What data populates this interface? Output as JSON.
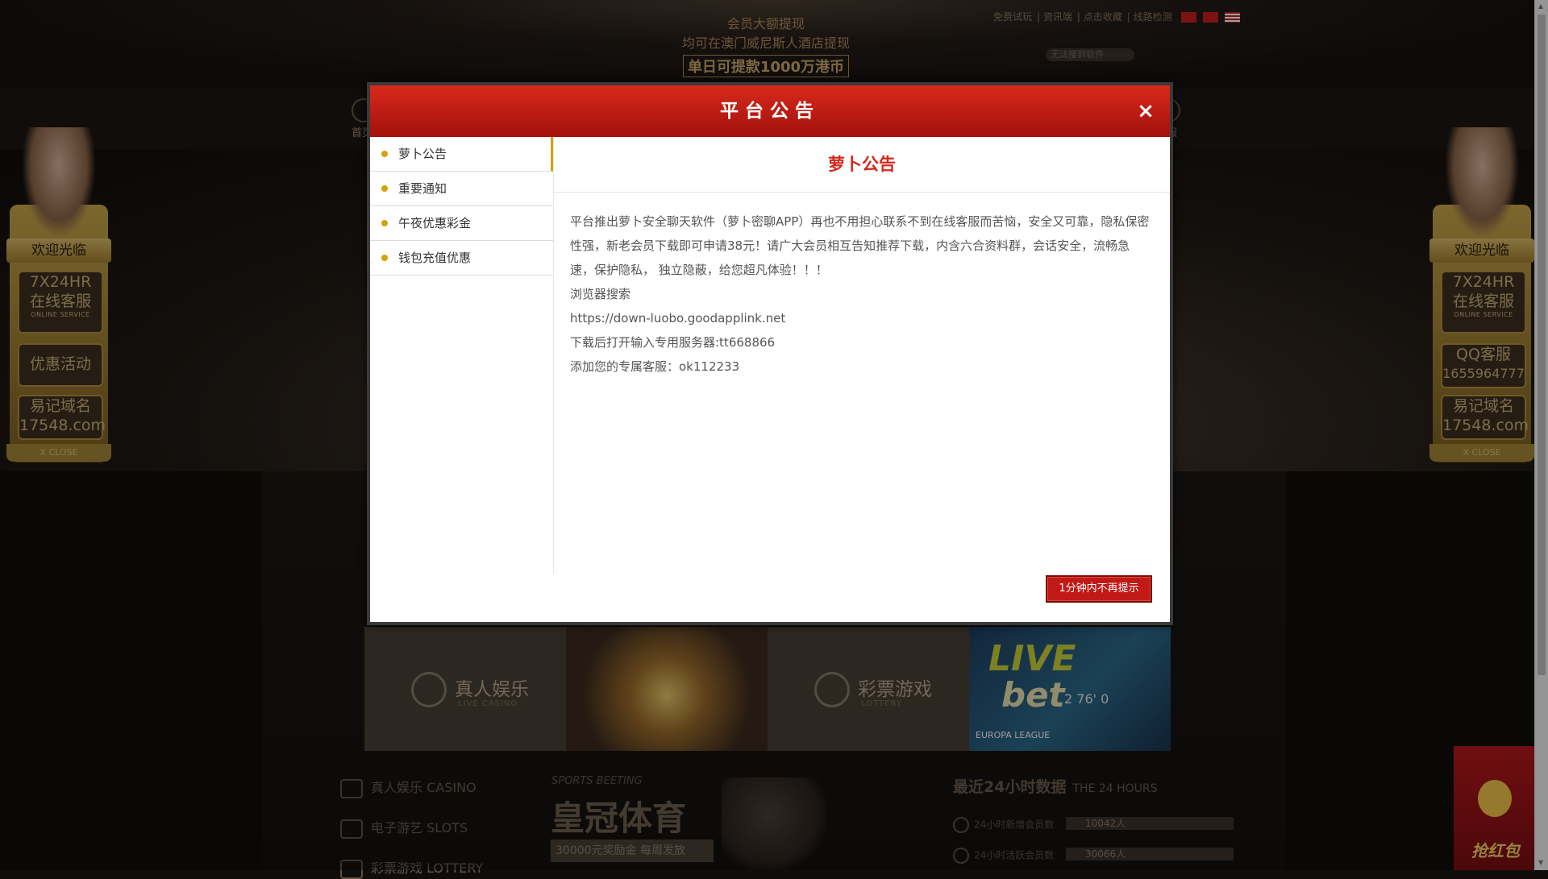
{
  "header": {
    "promo_line1": "会员大额提现",
    "promo_line2": "均可在澳门威尼斯人酒店提现",
    "promo_line3": "单日可提款1000万港币",
    "links": [
      "免费试玩",
      "资讯端",
      "点击收藏",
      "线路检测"
    ],
    "search_placeholder": "无法搜到软件"
  },
  "nav": {
    "home": "首页",
    "service": "客服"
  },
  "left_panel": {
    "welcome": "欢迎光临",
    "online_top": "7X24HR",
    "online_main": "在线客服",
    "online_en": "ONLINE SERVICE",
    "promo": "优惠活动",
    "domain_label": "易记域名",
    "domain": "17548.com",
    "close": "X CLOSE"
  },
  "right_panel": {
    "welcome": "欢迎光临",
    "online_top": "7X24HR",
    "online_main": "在线客服",
    "online_en": "ONLINE SERVICE",
    "qq_label": "QQ客服",
    "qq_number": "1655964777",
    "domain_label": "易记域名",
    "domain": "17548.com",
    "close": "X CLOSE"
  },
  "tiles": {
    "casino_cn": "真人娱乐",
    "casino_en": "LIVE CASINO",
    "lottery_cn": "彩票游戏",
    "lottery_en": "LOTTERY",
    "live_word": "LIVE",
    "bet_word": "bet",
    "score": "2  76'  0",
    "europa": "EUROPA LEAGUE"
  },
  "bottom": {
    "categories": [
      "真人娱乐 CASINO",
      "电子游艺 SLOTS",
      "彩票游戏 LOTTERY"
    ],
    "sports_en": "SPORTS BEETING",
    "sports_cn": "皇冠体育",
    "sports_bonus": "30000元奖励金 每周发放",
    "stats_title": "最近24小时数据",
    "stats_title_en": "THE 24 HOURS",
    "stat1_label": "24小时新增会员数",
    "stat1_value": "10042人",
    "stat2_label": "24小时活跃会员数",
    "stat2_value": "30066人"
  },
  "red_packet": {
    "label": "抢红包"
  },
  "modal": {
    "title": "平台公告",
    "close_symbol": "×",
    "tabs": [
      "萝卜公告",
      "重要通知",
      "午夜优惠彩金",
      "钱包充值优惠"
    ],
    "active_tab": 0,
    "content_title": "萝卜公告",
    "paragraph": "平台推出萝卜安全聊天软件（萝卜密聊APP）再也不用担心联系不到在线客服而苦恼，安全又可靠，隐私保密性强，新老会员下载即可申请38元！请广大会员相互告知推荐下载，内含六合资料群，会话安全，流畅急速，保护隐私， 独立隐蔽，给您超凡体验！！！",
    "line_search": "浏览器搜索",
    "line_url": "https://down-luobo.goodapplink.net",
    "line_server": "下载后打开输入专用服务器:tt668866",
    "line_contact": "添加您的专属客服：ok112233",
    "mute_button": "1分钟内不再提示"
  },
  "colors": {
    "accent_red": "#c11a16",
    "gold": "#d4a20b",
    "title_red": "#d1281c"
  }
}
